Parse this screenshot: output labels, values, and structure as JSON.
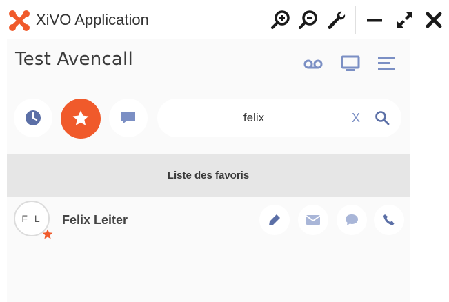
{
  "window": {
    "title": "XiVO Application",
    "icons": [
      "xivo-logo-icon",
      "zoom-in-icon",
      "zoom-out-icon",
      "wrench-icon",
      "minimize-icon",
      "maximize-icon",
      "close-icon"
    ]
  },
  "header": {
    "user_name": "Test Avencall",
    "icons": [
      "voicemail-icon",
      "monitor-icon",
      "menu-icon"
    ]
  },
  "toolbar": {
    "icons": [
      "history-clock-icon",
      "favorites-star-icon",
      "chat-icon"
    ],
    "active": "favorites-star-icon"
  },
  "search": {
    "value": "felix",
    "clear_label": "X"
  },
  "favorites": {
    "header": "Liste des favoris",
    "contacts": [
      {
        "initials": "F L",
        "name": "Felix Leiter",
        "favorite": true
      }
    ],
    "actions": [
      "edit-icon",
      "email-icon",
      "chat-icon",
      "phone-icon"
    ]
  },
  "colors": {
    "accent": "#f05a2b",
    "icon_blue": "#7b8fc4",
    "section_bg": "#e6e6e6"
  }
}
